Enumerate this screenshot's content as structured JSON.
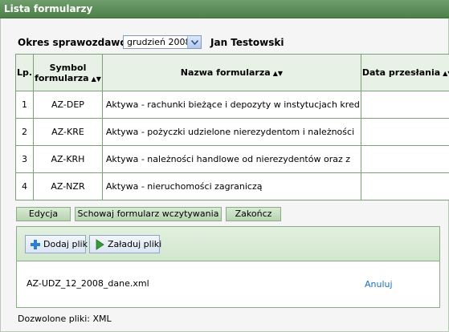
{
  "window": {
    "title": "Lista formularzy"
  },
  "period": {
    "label": "Okres sprawozdawczy",
    "selected": "grudzień 2008",
    "user": "Jan Testowski"
  },
  "table": {
    "headers": {
      "lp": "Lp.",
      "symbol_line1": "Symbol",
      "symbol_line2": "formularza",
      "name": "Nazwa formularza",
      "date": "Data przesłania"
    },
    "rows": [
      {
        "lp": "1",
        "symbol": "AZ-DEP",
        "name": "Aktywa - rachunki bieżące i depozyty w instytucjach kred",
        "date": ""
      },
      {
        "lp": "2",
        "symbol": "AZ-KRE",
        "name": "Aktywa - pożyczki udzielone nierezydentom i należności",
        "date": ""
      },
      {
        "lp": "3",
        "symbol": "AZ-KRH",
        "name": "Aktywa - należności handlowe od nierezydentów oraz z",
        "date": ""
      },
      {
        "lp": "4",
        "symbol": "AZ-NZR",
        "name": "Aktywa - nieruchomości zagraniczą",
        "date": ""
      }
    ]
  },
  "buttons": {
    "edit": "Edycja",
    "hide_form": "Schowaj formularz wczytywania",
    "finish": "Zakończ"
  },
  "upload": {
    "add_file": "Dodaj plik",
    "upload_files": "Załaduj pliki",
    "file_name": "AZ-UDZ_12_2008_dane.xml",
    "cancel": "Anuluj",
    "allowed": "Dozwolone pliki: XML"
  },
  "colors": {
    "titlebar": "#5a8c57",
    "header_bg": "#e7f1e5",
    "border": "#7da07a",
    "link": "#1b6ec4"
  }
}
